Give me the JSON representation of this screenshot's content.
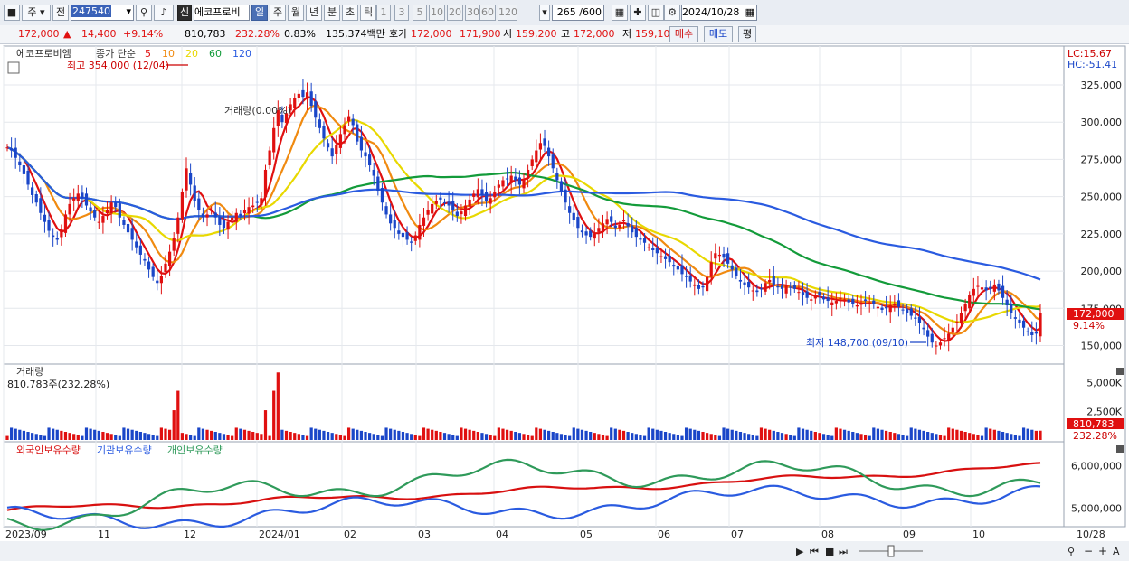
{
  "toolbar": {
    "period_day_label": "주",
    "sel_label": "전",
    "stock_code": "247540",
    "new_badge": "신",
    "stock_name": "에코프로비",
    "period_tabs": [
      "일",
      "주",
      "월",
      "년",
      "분",
      "초",
      "틱"
    ],
    "active_period": "일",
    "minute_options": [
      "1",
      "3",
      "5",
      "10",
      "20",
      "30",
      "60",
      "120"
    ],
    "count_display": "265 /600",
    "date_value": "2024/10/28"
  },
  "infobar": {
    "price": "172,000",
    "change_arrow": "▲",
    "change": "14,400",
    "change_pct": "+9.14%",
    "volume": "810,783",
    "volume_ratio": "232.28%",
    "turnover": "0.83%",
    "trade_amount": "135,374백만",
    "quote_label": "호가",
    "ask": "172,000",
    "bid": "171,900",
    "open_label": "시",
    "open": "159,200",
    "high_label": "고",
    "high": "172,000",
    "low_label": "저",
    "low": "159,100",
    "buy_button": "매수",
    "sell_button": "매도",
    "eval_button": "평"
  },
  "price_panel": {
    "stock_tag": "에코프로비엠",
    "legend_prefix": "종가 단순",
    "ma_labels": [
      "5",
      "10",
      "20",
      "60",
      "120"
    ],
    "ma_colors": [
      "#e01010",
      "#f08a10",
      "#e8d800",
      "#139b3a",
      "#2a5be0"
    ],
    "high_annotation": "최고 354,000 (12/04)",
    "low_annotation": "최저 148,700 (09/10)",
    "volume_note": "거래량(0.00%)",
    "lc_label": "LC:15.67",
    "hc_label": "HC:-51.41",
    "price_ticks": [
      "325,000",
      "300,000",
      "275,000",
      "250,000",
      "225,000",
      "200,000",
      "175,000",
      "150,000"
    ],
    "current_price_tag": "172,000",
    "current_pct_tag": "9.14%"
  },
  "volume_panel": {
    "title": "거래량",
    "summary": "810,783주(232.28%)",
    "ticks": [
      "5,000K",
      "2,500K"
    ],
    "current_tag": "810,783",
    "current_pct": "232.28%"
  },
  "holding_panel": {
    "legends": [
      "외국인보유수량",
      "기관보유수량",
      "개인보유수량"
    ],
    "colors": [
      "#d81010",
      "#2a5be0",
      "#2f9a5a"
    ],
    "ticks": [
      "6,000,000",
      "5,000,000"
    ]
  },
  "x_axis": {
    "labels": [
      "2023/09",
      "11",
      "12",
      "2024/01",
      "02",
      "03",
      "04",
      "05",
      "06",
      "07",
      "08",
      "09",
      "10",
      "10/28"
    ]
  },
  "chart_data": {
    "type": "candlestick",
    "ylim": [
      140000,
      345000
    ],
    "closes": [
      283000,
      281000,
      276000,
      271000,
      265000,
      258000,
      251000,
      246000,
      239000,
      233000,
      227000,
      223000,
      221000,
      228000,
      238000,
      245000,
      249000,
      252000,
      249000,
      244000,
      240000,
      236000,
      233000,
      237000,
      241000,
      246000,
      243000,
      236000,
      231000,
      226000,
      221000,
      216000,
      211000,
      207000,
      201000,
      196000,
      192000,
      197000,
      205000,
      213000,
      222000,
      236000,
      253000,
      269000,
      258000,
      247000,
      241000,
      236000,
      238000,
      241000,
      236000,
      231000,
      229000,
      233000,
      236000,
      239000,
      237000,
      241000,
      243000,
      244000,
      246000,
      249000,
      268000,
      281000,
      296000,
      308000,
      300000,
      306000,
      312000,
      316000,
      319000,
      317000,
      320000,
      311000,
      303000,
      296000,
      289000,
      283000,
      277000,
      285000,
      292000,
      298000,
      304000,
      298000,
      287000,
      281000,
      277000,
      271000,
      264000,
      254000,
      246000,
      238000,
      232000,
      229000,
      225000,
      223000,
      221000,
      219000,
      224000,
      231000,
      236000,
      241000,
      245000,
      247000,
      248000,
      246000,
      244000,
      241000,
      237000,
      240000,
      244000,
      248000,
      252000,
      255000,
      251000,
      247000,
      249000,
      253000,
      258000,
      261000,
      262000,
      264000,
      261000,
      258000,
      262000,
      268000,
      275000,
      281000,
      286000,
      284000,
      277000,
      269000,
      261000,
      253000,
      246000,
      239000,
      234000,
      229000,
      226000,
      224000,
      223000,
      225000,
      229000,
      232000,
      235000,
      233000,
      229000,
      231000,
      234000,
      230000,
      226000,
      223000,
      221000,
      219000,
      216000,
      214000,
      212000,
      210000,
      208000,
      206000,
      203000,
      201000,
      198000,
      196000,
      193000,
      191000,
      188000,
      189000,
      196000,
      206000,
      212000,
      211000,
      209000,
      205000,
      201000,
      197000,
      193000,
      191000,
      189000,
      187000,
      186000,
      188000,
      192000,
      194000,
      191000,
      189000,
      188000,
      190000,
      189000,
      188000,
      186000,
      184000,
      182000,
      181000,
      183000,
      184000,
      181000,
      180000,
      179000,
      180000,
      182000,
      181000,
      179000,
      178000,
      177000,
      178000,
      180000,
      179000,
      178000,
      176000,
      174000,
      175000,
      177000,
      178000,
      176000,
      174000,
      172000,
      170000,
      168000,
      165000,
      161000,
      156000,
      152000,
      150000,
      152000,
      155000,
      158000,
      162000,
      166000,
      172000,
      178000,
      184000,
      188000,
      190000,
      189000,
      187000,
      188000,
      191000,
      187000,
      182000,
      177000,
      172000,
      168000,
      165000,
      162000,
      159000,
      157000,
      158000,
      172000
    ],
    "events": {
      "high": {
        "value": 354000,
        "date": "12/04"
      },
      "low": {
        "value": 148700,
        "date": "09/10"
      }
    },
    "volume_ylim": [
      0,
      6000000
    ],
    "holdings": {
      "foreign_start": 4950000,
      "foreign_end": 6180000,
      "institution_start": 4700000,
      "institution_end": 5400000,
      "individual_start": 4700000,
      "individual_end": 5500000
    }
  }
}
